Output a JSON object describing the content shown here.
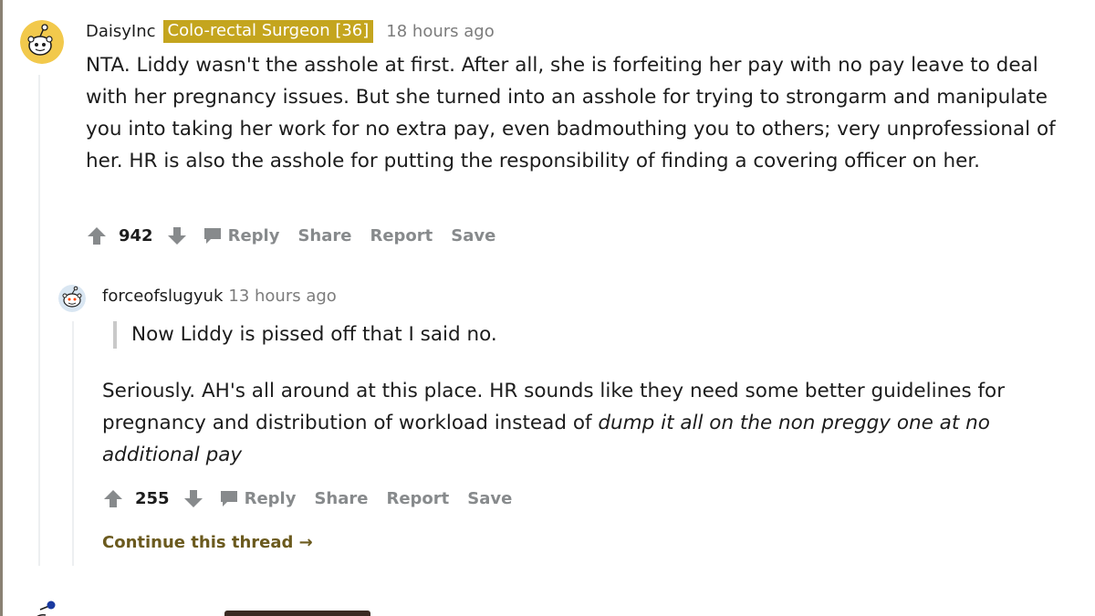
{
  "comment1": {
    "username": "DaisyInc",
    "flair": "Colo-rectal Surgeon [36]",
    "timestamp": "18 hours ago",
    "body": "NTA. Liddy wasn't the asshole at first. After all, she is forfeiting her pay with no pay leave to deal with her pregnancy issues. But she turned into an asshole for trying to strongarm and manipulate you into taking her work for no extra pay, even badmouthing you to others; very unprofessional of her. HR is also the asshole for putting the responsibility of finding a covering officer on her.",
    "votes": "942",
    "actions": {
      "reply": "Reply",
      "share": "Share",
      "report": "Report",
      "save": "Save"
    }
  },
  "comment2": {
    "username": "forceofslugyuk",
    "timestamp": "13 hours ago",
    "quote": "Now Liddy is pissed off that I said no.",
    "body_plain": "Seriously. AH's all around at this place. HR sounds like they need some better guidelines for pregnancy and distribution of workload instead of ",
    "body_italic": "dump it all on the non preggy one at no additional pay",
    "votes": "255",
    "actions": {
      "reply": "Reply",
      "share": "Share",
      "report": "Report",
      "save": "Save"
    }
  },
  "continue_thread": "Continue this thread →",
  "colors": {
    "flair_bg": "#c4a51e",
    "action_gray": "#878a8c",
    "continue_link": "#6b5a1e",
    "avatar_yellow": "#f2c94c"
  }
}
